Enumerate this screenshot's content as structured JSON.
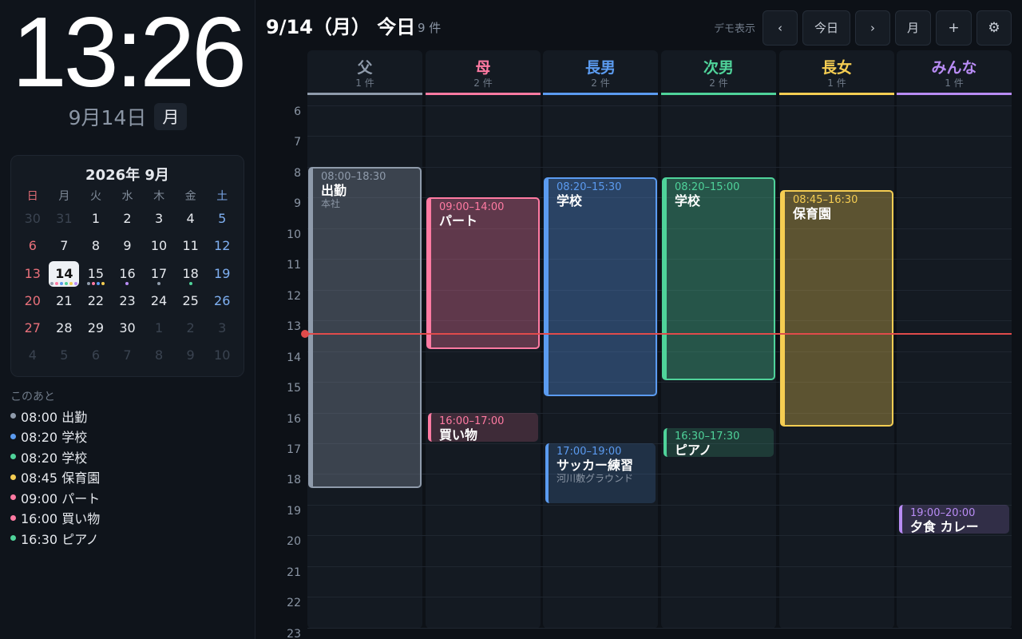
{
  "clock": {
    "time": "13:26",
    "date": "9月14日",
    "weekday": "月"
  },
  "mini_calendar": {
    "title": "2026年 9月",
    "weekdays": [
      "日",
      "月",
      "火",
      "水",
      "木",
      "金",
      "土"
    ],
    "weeks": [
      [
        {
          "d": "30",
          "other": true
        },
        {
          "d": "31",
          "other": true
        },
        {
          "d": "1"
        },
        {
          "d": "2"
        },
        {
          "d": "3"
        },
        {
          "d": "4"
        },
        {
          "d": "5"
        }
      ],
      [
        {
          "d": "6"
        },
        {
          "d": "7"
        },
        {
          "d": "8"
        },
        {
          "d": "9"
        },
        {
          "d": "10"
        },
        {
          "d": "11"
        },
        {
          "d": "12"
        }
      ],
      [
        {
          "d": "13"
        },
        {
          "d": "14",
          "today": true,
          "dots": [
            "#8f9bab",
            "#ff7aa2",
            "#5b9bf0",
            "#4fd39a",
            "#f5cd52",
            "#b98cf5"
          ]
        },
        {
          "d": "15",
          "dots": [
            "#8f9bab",
            "#ff7aa2",
            "#5b9bf0",
            "#f5cd52"
          ]
        },
        {
          "d": "16",
          "dots": [
            "#b98cf5"
          ]
        },
        {
          "d": "17",
          "dots": [
            "#8f9bab"
          ]
        },
        {
          "d": "18",
          "dots": [
            "#4fd39a"
          ]
        },
        {
          "d": "19"
        }
      ],
      [
        {
          "d": "20"
        },
        {
          "d": "21"
        },
        {
          "d": "22"
        },
        {
          "d": "23"
        },
        {
          "d": "24"
        },
        {
          "d": "25"
        },
        {
          "d": "26"
        }
      ],
      [
        {
          "d": "27"
        },
        {
          "d": "28"
        },
        {
          "d": "29"
        },
        {
          "d": "30"
        },
        {
          "d": "1",
          "other": true
        },
        {
          "d": "2",
          "other": true
        },
        {
          "d": "3",
          "other": true
        }
      ],
      [
        {
          "d": "4",
          "other": true
        },
        {
          "d": "5",
          "other": true
        },
        {
          "d": "6",
          "other": true
        },
        {
          "d": "7",
          "other": true
        },
        {
          "d": "8",
          "other": true
        },
        {
          "d": "9",
          "other": true
        },
        {
          "d": "10",
          "other": true
        }
      ]
    ]
  },
  "upcoming": {
    "label": "このあと",
    "items": [
      {
        "text": "08:00 出勤",
        "color": "#8f9bab"
      },
      {
        "text": "08:20 学校",
        "color": "#5b9bf0"
      },
      {
        "text": "08:20 学校",
        "color": "#4fd39a"
      },
      {
        "text": "08:45 保育園",
        "color": "#f5cd52"
      },
      {
        "text": "09:00 パート",
        "color": "#ff7aa2"
      },
      {
        "text": "16:00 買い物",
        "color": "#ff7aa2"
      },
      {
        "text": "16:30 ピアノ",
        "color": "#4fd39a"
      }
    ]
  },
  "header": {
    "title": "9/14（月） 今日",
    "count": "9 件",
    "demo_label": "デモ表示",
    "buttons": {
      "prev": "‹",
      "today": "今日",
      "next": "›",
      "month": "月",
      "add": "+",
      "settings": "⚙"
    }
  },
  "hours": [
    "6",
    "7",
    "8",
    "9",
    "10",
    "11",
    "12",
    "13",
    "14",
    "15",
    "16",
    "17",
    "18",
    "19",
    "20",
    "21",
    "22",
    "23"
  ],
  "now": "13:26",
  "members": [
    {
      "name": "父",
      "count": "1 件",
      "color": "#8f9bab",
      "events": [
        {
          "start": "08:00",
          "end": "18:30",
          "time": "08:00–18:30",
          "title": "出勤",
          "location": "本社",
          "style": "block"
        }
      ]
    },
    {
      "name": "母",
      "count": "2 件",
      "color": "#ff7aa2",
      "events": [
        {
          "start": "09:00",
          "end": "14:00",
          "time": "09:00–14:00",
          "title": "パート",
          "location": "",
          "style": "block"
        },
        {
          "start": "16:00",
          "end": "17:00",
          "time": "16:00–17:00",
          "title": "買い物",
          "location": "",
          "style": "soft"
        }
      ]
    },
    {
      "name": "長男",
      "count": "2 件",
      "color": "#5b9bf0",
      "events": [
        {
          "start": "08:20",
          "end": "15:30",
          "time": "08:20–15:30",
          "title": "学校",
          "location": "",
          "style": "block"
        },
        {
          "start": "17:00",
          "end": "19:00",
          "time": "17:00–19:00",
          "title": "サッカー練習",
          "location": "河川敷グラウンド",
          "style": "soft"
        }
      ]
    },
    {
      "name": "次男",
      "count": "2 件",
      "color": "#4fd39a",
      "events": [
        {
          "start": "08:20",
          "end": "15:00",
          "time": "08:20–15:00",
          "title": "学校",
          "location": "",
          "style": "block"
        },
        {
          "start": "16:30",
          "end": "17:30",
          "time": "16:30–17:30",
          "title": "ピアノ",
          "location": "",
          "style": "soft"
        }
      ]
    },
    {
      "name": "長女",
      "count": "1 件",
      "color": "#f5cd52",
      "events": [
        {
          "start": "08:45",
          "end": "16:30",
          "time": "08:45–16:30",
          "title": "保育園",
          "location": "",
          "style": "block"
        }
      ]
    },
    {
      "name": "みんな",
      "count": "1 件",
      "color": "#b98cf5",
      "events": [
        {
          "start": "19:00",
          "end": "20:00",
          "time": "19:00–20:00",
          "title": "夕食 カレー",
          "location": "",
          "style": "soft"
        }
      ]
    }
  ]
}
